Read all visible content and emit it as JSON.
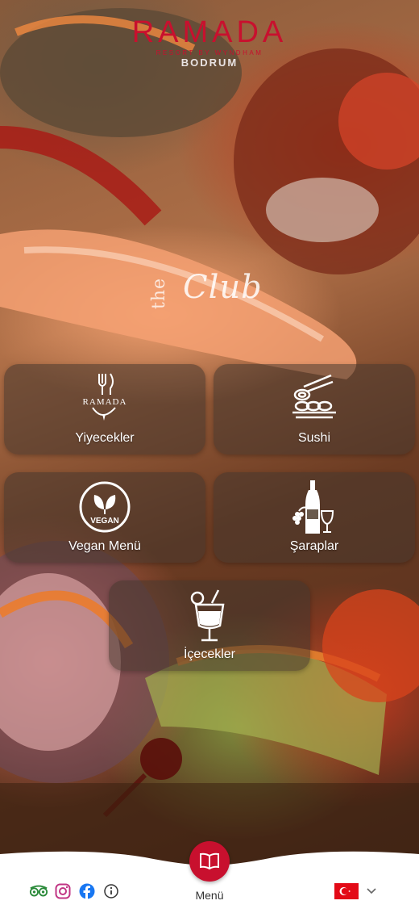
{
  "header": {
    "brand": "RAMADA",
    "subbrand": "RESORT BY WYNDHAM",
    "location": "BODRUM"
  },
  "venue": {
    "prefix": "the",
    "name": "Club"
  },
  "categories": [
    {
      "label": "Yiyecekler",
      "icon": "ramada-food-icon"
    },
    {
      "label": "Sushi",
      "icon": "sushi-icon"
    },
    {
      "label": "Vegan Menü",
      "icon": "vegan-icon"
    },
    {
      "label": "Şaraplar",
      "icon": "wine-icon"
    },
    {
      "label": "İçecekler",
      "icon": "cocktail-icon"
    }
  ],
  "bottom_nav": {
    "menu_label": "Menü",
    "social": [
      "tripadvisor-icon",
      "instagram-icon",
      "facebook-icon",
      "info-icon"
    ],
    "language_flag": "turkey-flag-icon"
  },
  "colors": {
    "brand_red": "#c8102e",
    "tile_bg": "rgba(70,55,45,0.55)",
    "bar_bg": "#ffffff",
    "instagram": "#c13584",
    "facebook": "#1877f2",
    "tripadvisor": "#34a853"
  }
}
